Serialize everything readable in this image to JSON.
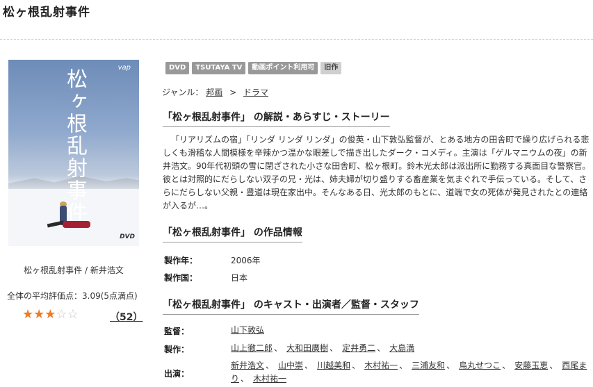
{
  "page": {
    "title": "松ヶ根乱射事件"
  },
  "jacket": {
    "title": "松ヶ根乱射事件",
    "logo": "vap",
    "dvd_mark": "DVD"
  },
  "left": {
    "caption": "松ヶ根乱射事件 / 新井浩文",
    "rating_text": "全体の平均評価点：3.09(5点満点)",
    "rating_value": 3.09,
    "rating_max": 5,
    "review_count": "（52）"
  },
  "tags": [
    "DVD",
    "TSUTAYA TV",
    "動画ポイント利用可",
    "旧作"
  ],
  "genre": {
    "label": "ジャンル：",
    "items": [
      "邦画",
      "ドラマ"
    ],
    "separator": ">"
  },
  "synopsis": {
    "heading": "「松ヶ根乱射事件」 の解説・あらすじ・ストーリー",
    "text": "「リアリズムの宿」「リンダ リンダ リンダ」の俊英・山下敦弘監督が、とある地方の田舎町で繰り広げられる悲しくも滑稽な人間模様を辛辣かつ温かな眼差しで描き出したダーク・コメディ。主演は「ゲルマニウムの夜」の新井浩文。90年代初頭の雪に閉ざされた小さな田舎町、松ヶ根町。鈴木光太郎は派出所に勤務する真面目な警察官。彼とは対照的にだらしない双子の兄・光は、姉夫婦が切り盛りする畜産業を気まぐれで手伝っている。そして、さらにだらしない父親・豊道は現在家出中。そんなある日、光太郎のもとに、道端で女の死体が発見されたとの連絡が入るが…。"
  },
  "work_info": {
    "heading": "「松ヶ根乱射事件」 の作品情報",
    "rows": [
      {
        "label": "製作年：",
        "value": "2006年"
      },
      {
        "label": "製作国：",
        "value": "日本"
      }
    ]
  },
  "cast": {
    "heading": "「松ヶ根乱射事件」 のキャスト・出演者／監督・スタッフ",
    "director_label": "監督：",
    "directors": [
      "山下敦弘"
    ],
    "producer_label": "製作：",
    "producers": [
      "山上徹二郎",
      "大和田廣樹",
      "定井勇二",
      "大島満"
    ],
    "actor_label": "出演：",
    "actors": [
      "新井浩文",
      "山中崇",
      "川越美和",
      "木村祐一",
      "三浦友和",
      "烏丸せつこ",
      "安藤玉恵",
      "西尾まり",
      "木村祐一"
    ]
  },
  "colors": {
    "star_on": "#f07a28",
    "star_off": "#c8c8c8",
    "tag_dark": "#999999",
    "tag_light": "#cfcfcf"
  }
}
